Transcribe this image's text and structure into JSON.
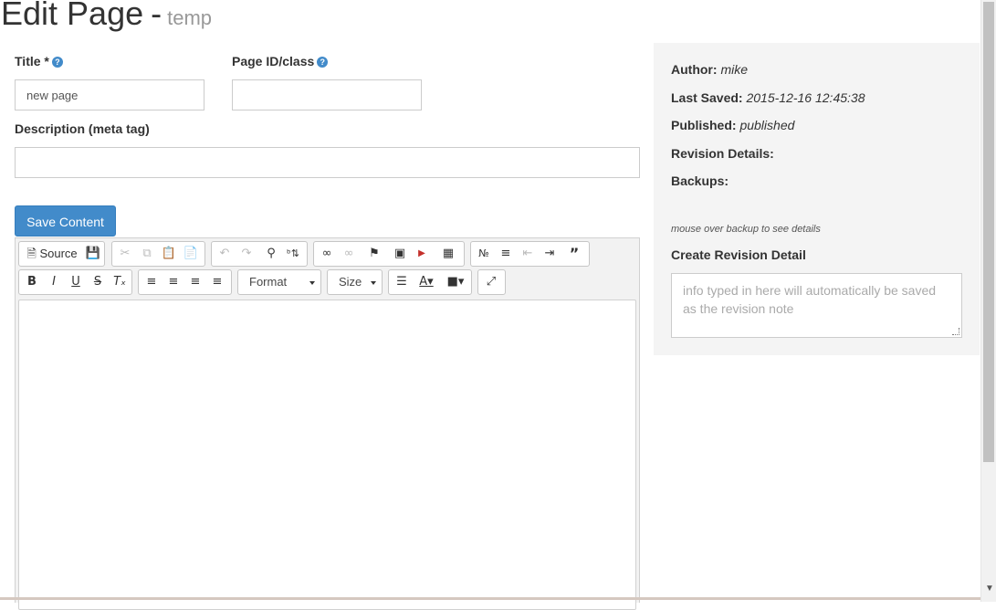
{
  "header": {
    "title": "Edit Page",
    "separator": "-",
    "subtitle": "temp"
  },
  "form": {
    "title_label": "Title *",
    "title_value": "new page",
    "pageid_label": "Page ID/class",
    "pageid_value": "",
    "description_label": "Description (meta tag)",
    "description_value": "",
    "help_glyph": "?",
    "save_label": "Save Content"
  },
  "toolbar": {
    "source_label": "Source",
    "format_label": "Format",
    "size_label": "Size",
    "icons": [
      "source-icon",
      "save-icon",
      "cut-icon",
      "copy-icon",
      "paste-icon",
      "paste-text-icon",
      "undo-icon",
      "redo-icon",
      "find-icon",
      "replace-icon",
      "link-icon",
      "unlink-icon",
      "anchor-icon",
      "image-icon",
      "youtube-icon",
      "table-icon",
      "numbered-list-icon",
      "bulleted-list-icon",
      "outdent-icon",
      "indent-icon",
      "blockquote-icon",
      "bold-icon",
      "italic-icon",
      "underline-icon",
      "strike-icon",
      "remove-format-icon",
      "align-left-icon",
      "align-center-icon",
      "align-right-icon",
      "justify-icon",
      "horizontal-rule-icon",
      "text-color-icon",
      "background-color-icon",
      "maximize-icon"
    ]
  },
  "sidebar": {
    "author_label": "Author:",
    "author_value": "mike",
    "last_saved_label": "Last Saved:",
    "last_saved_value": "2015-12-16 12:45:38",
    "published_label": "Published:",
    "published_value": "published",
    "revision_details_label": "Revision Details:",
    "backups_label": "Backups:",
    "backup_hint": "mouse over backup to see details",
    "create_revision_label": "Create Revision Detail",
    "revision_placeholder": "info typed in here will automatically be saved as the revision note"
  },
  "colors": {
    "primary": "#428bca",
    "sidebar_bg": "#f4f4f4"
  }
}
